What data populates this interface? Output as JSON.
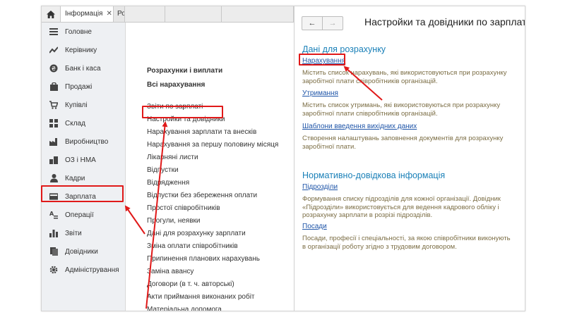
{
  "tabs": [
    {
      "label": "Інформація",
      "close": "✕"
    },
    {
      "label": "Ро"
    }
  ],
  "sidebar": {
    "items": [
      {
        "label": "Головне",
        "icon": "menu-lines-icon"
      },
      {
        "label": "Керівнику",
        "icon": "trend-chart-icon"
      },
      {
        "label": "Банк і каса",
        "icon": "coin-icon"
      },
      {
        "label": "Продажі",
        "icon": "shopping-bag-icon"
      },
      {
        "label": "Купівлі",
        "icon": "cart-icon"
      },
      {
        "label": "Склад",
        "icon": "warehouse-grid-icon"
      },
      {
        "label": "Виробництво",
        "icon": "factory-icon"
      },
      {
        "label": "ОЗ і НМА",
        "icon": "assets-icon"
      },
      {
        "label": "Кадри",
        "icon": "person-icon"
      },
      {
        "label": "Зарплата",
        "icon": "money-card-icon"
      },
      {
        "label": "Операції",
        "icon": "operations-icon"
      },
      {
        "label": "Звіти",
        "icon": "bar-chart-icon"
      },
      {
        "label": "Довідники",
        "icon": "books-icon"
      },
      {
        "label": "Адміністрування",
        "icon": "gear-icon"
      }
    ],
    "selected": "Зарплата"
  },
  "middle": {
    "header1": "Розрахунки і виплати",
    "header2": "Всі нарахування",
    "items": [
      "Звіти по зарплаті",
      "Настройки та довідники",
      "Нарахування зарплати та внесків",
      "Нарахування за першу половину місяця",
      "Лікарняні листи",
      "Відпустки",
      "Відрядження",
      "Відпустки без збереження оплати",
      "Простої співробітників",
      "Прогули, неявки",
      "Дані для розрахунку зарплати",
      "Зміна оплати співробітників",
      "Припинення планових нарахувань",
      "Заміна авансу",
      "Договори (в т. ч. авторські)",
      "Акти приймання виконаних робіт",
      "Матеріальна допомога"
    ]
  },
  "right": {
    "back": "←",
    "forward": "→",
    "title": "Настройки та довідники по зарплаті",
    "section1": {
      "title": "Дані для розрахунку",
      "links": [
        {
          "label": "Нарахування",
          "desc": "Містить список нарахувань, які використовуються при розрахунку заробітної плати співробітників організацій."
        },
        {
          "label": "Утримання",
          "desc": "Містить список утримань, які використовуються при розрахунку заробітної плати співробітників організацій."
        },
        {
          "label": "Шаблони введення вихідних даних",
          "desc": "Створення налаштувань заповнення документів для розрахунку заробітної плати."
        }
      ]
    },
    "section2": {
      "title": "Нормативно-довідкова інформація",
      "links": [
        {
          "label": "Підрозділи",
          "desc": "Формування списку підрозділів для кожної організації. Довідник «Підрозділи» використовується для ведення кадрового обліку і розрахунку зарплати в розрізі підрозділів."
        },
        {
          "label": "Посади",
          "desc": "Посади, професії і спеціальності, за якою співробітники виконують в організації роботу згідно з трудовим договором."
        }
      ]
    }
  },
  "colors": {
    "highlight": "#e01919",
    "link": "#1f55a8",
    "section_title": "#1a80b8",
    "description": "#7b6d44",
    "sidebar_bg": "#eef0f3"
  }
}
